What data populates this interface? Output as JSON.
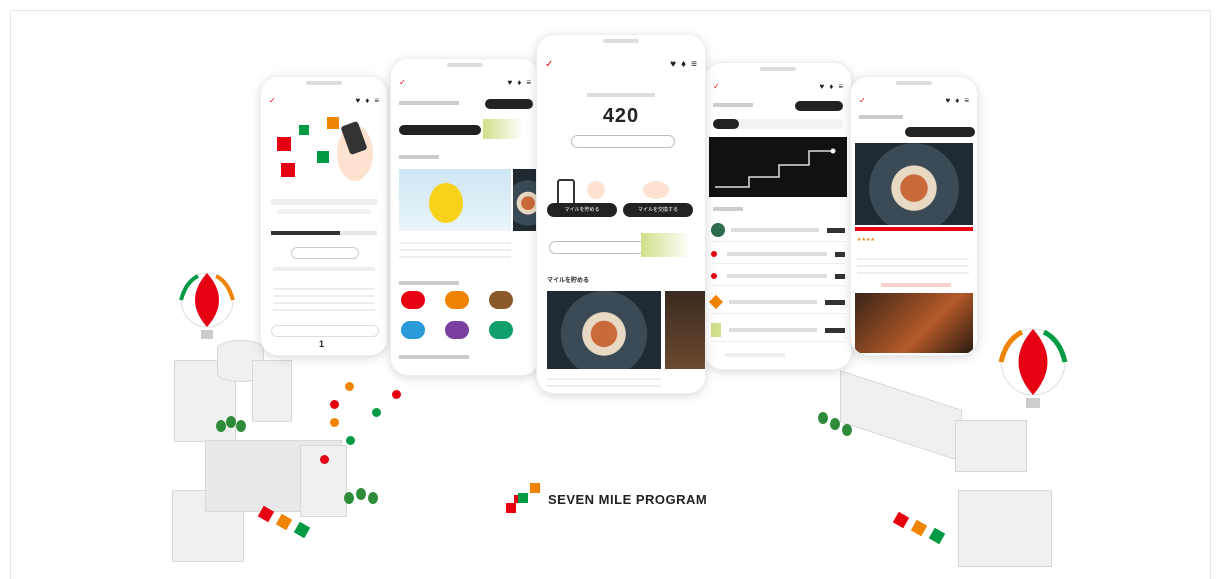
{
  "brand": {
    "name": "SEVEN MILE PROGRAM"
  },
  "phone_center": {
    "big_number": "420",
    "button_primary_1": "マイルを貯める",
    "button_primary_2": "マイルを交換する",
    "section_title": "マイルを貯める"
  },
  "icons": [
    "heart-icon",
    "bell-icon",
    "menu-icon",
    "chevron-right-icon"
  ],
  "colors": {
    "red": "#e60012",
    "orange": "#f08300",
    "green": "#009944",
    "dark": "#222222"
  }
}
